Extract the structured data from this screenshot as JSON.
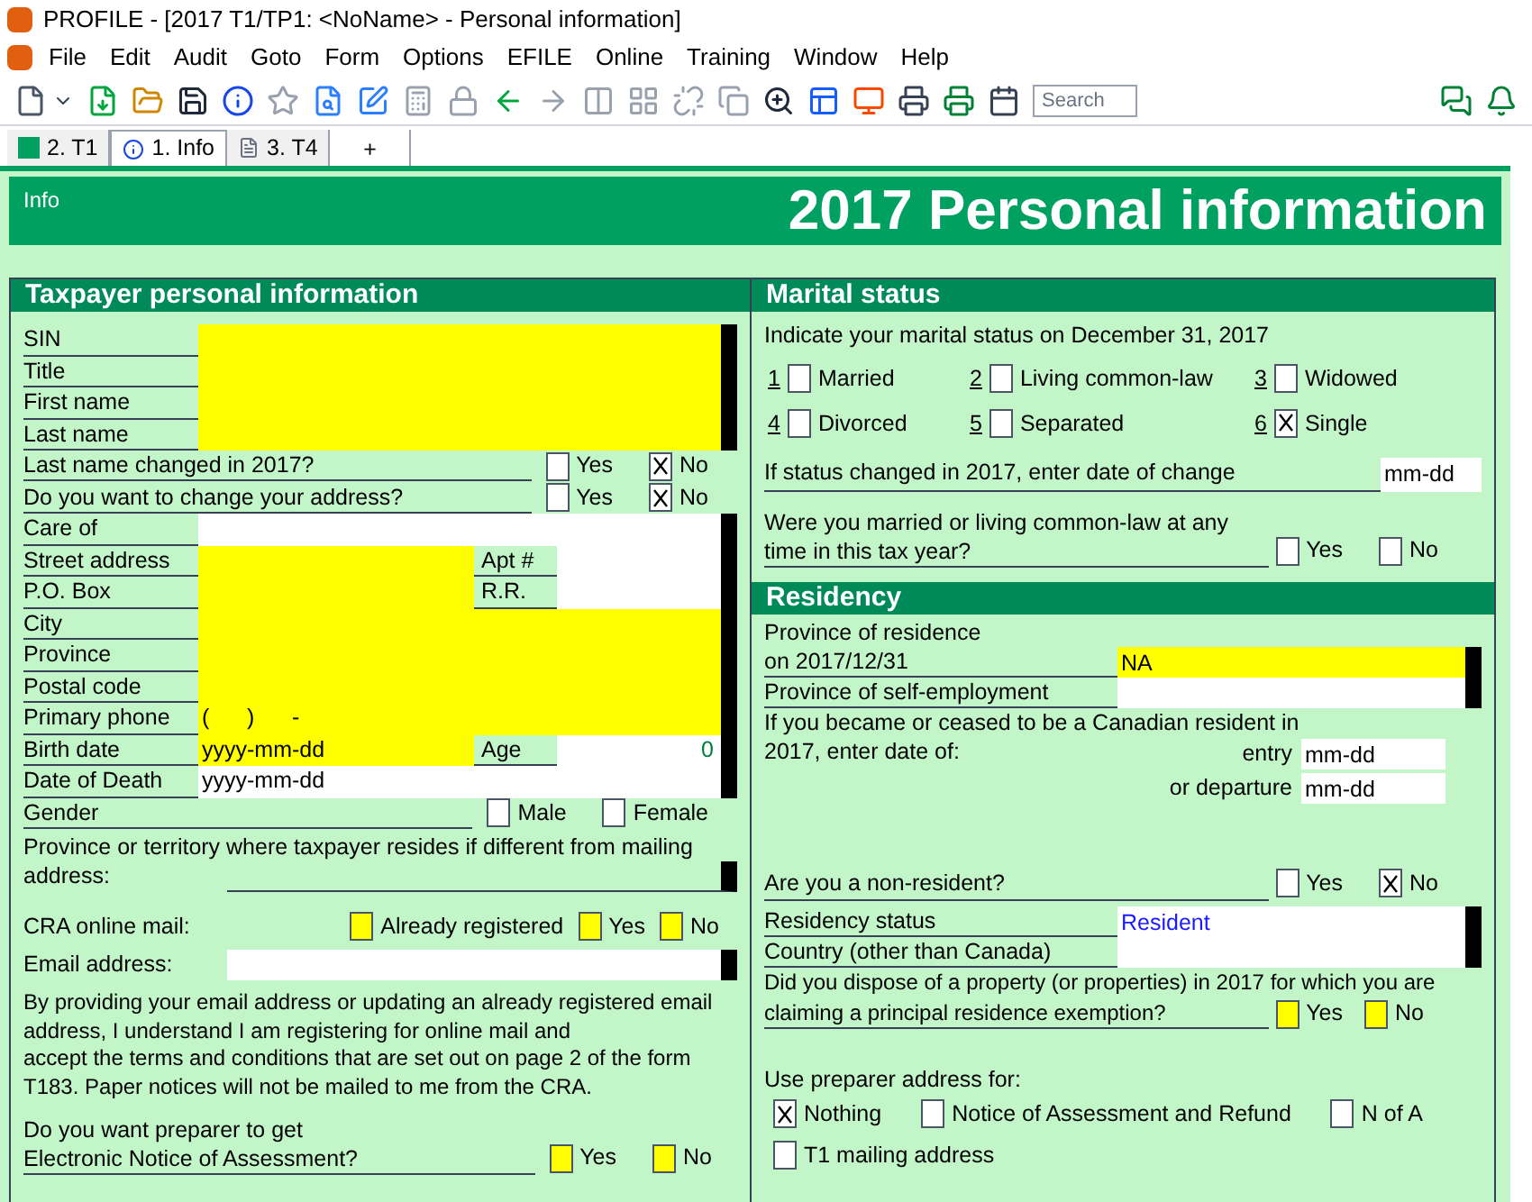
{
  "window": {
    "title": "PROFILE - [2017 T1/TP1: <NoName> - Personal information]"
  },
  "menu": [
    "File",
    "Edit",
    "Audit",
    "Goto",
    "Form",
    "Options",
    "EFILE",
    "Online",
    "Training",
    "Window",
    "Help"
  ],
  "toolbar": {
    "search_placeholder": "Search"
  },
  "tabs": [
    {
      "label": "2. T1",
      "selected": false
    },
    {
      "label": "1. Info",
      "selected": true
    },
    {
      "label": "3. T4",
      "selected": false
    }
  ],
  "add_tab": "+",
  "header": {
    "tag": "Info",
    "title": "2017 Personal information"
  },
  "taxpayer": {
    "title": "Taxpayer personal information",
    "rows": [
      {
        "kind": "field",
        "label": "SIN",
        "required": true
      },
      {
        "kind": "field",
        "label": "Title",
        "required": true
      },
      {
        "kind": "field",
        "label": "First name",
        "required": true
      },
      {
        "kind": "field",
        "label": "Last name",
        "required": true
      },
      {
        "kind": "choice",
        "label": "Last name changed in 2017?",
        "options": [
          {
            "label": "Yes",
            "checked": false
          },
          {
            "label": "No",
            "checked": true
          }
        ]
      },
      {
        "kind": "choice",
        "label": "Do you want to change your address?",
        "options": [
          {
            "label": "Yes",
            "checked": false
          },
          {
            "label": "No",
            "checked": true
          }
        ]
      },
      {
        "kind": "field",
        "label": "Care of",
        "required": false
      },
      {
        "kind": "field",
        "label": "Street address",
        "required": true,
        "side": {
          "label": "Apt #"
        }
      },
      {
        "kind": "field",
        "label": "P.O. Box",
        "required": true,
        "side": {
          "label": "R.R."
        }
      },
      {
        "kind": "field",
        "label": "City",
        "required": true
      },
      {
        "kind": "field",
        "label": "Province",
        "required": true
      },
      {
        "kind": "field",
        "label": "Postal code",
        "required": true
      },
      {
        "kind": "field",
        "label": "Primary phone",
        "required": true,
        "value": "(      )      -"
      },
      {
        "kind": "field",
        "label": "Birth date",
        "required": true,
        "value": "yyyy-mm-dd",
        "side": {
          "label": "Age",
          "value": "0"
        }
      },
      {
        "kind": "field",
        "label": "Date of Death",
        "required": false,
        "value": "yyyy-mm-dd"
      },
      {
        "kind": "choice",
        "label": "Gender",
        "options": [
          {
            "label": "Male",
            "checked": false
          },
          {
            "label": "Female",
            "checked": false
          }
        ]
      }
    ],
    "residence_question": [
      "Province or territory where taxpayer resides if different from mailing",
      "address:"
    ],
    "cra_mail": {
      "label": "CRA online mail:",
      "options": [
        {
          "label": "Already registered",
          "checked": false,
          "required": true
        },
        {
          "label": "Yes",
          "checked": false,
          "required": true
        },
        {
          "label": "No",
          "checked": false,
          "required": true
        }
      ]
    },
    "email": {
      "label": "Email address:"
    },
    "consent": "By providing your email address or updating an already registered email\naddress, I understand I am registering for online mail and\naccept the terms and conditions that are set out on page 2 of the form\nT183. Paper notices will not be mailed to me from the CRA.",
    "preparer_noa": {
      "label": "Do you want preparer to get\nElectronic Notice of Assessment?",
      "options": [
        {
          "label": "Yes",
          "checked": false,
          "required": true
        },
        {
          "label": "No",
          "checked": false,
          "required": true
        }
      ]
    }
  },
  "marital": {
    "title": "Marital status",
    "intro": "Indicate your marital status on December 31, 2017",
    "options": [
      {
        "number": "1",
        "label": "Married",
        "checked": false
      },
      {
        "number": "2",
        "label": "Living common-law",
        "checked": false
      },
      {
        "number": "3",
        "label": "Widowed",
        "checked": false
      },
      {
        "number": "4",
        "label": "Divorced",
        "checked": false
      },
      {
        "number": "5",
        "label": "Separated",
        "checked": false
      },
      {
        "number": "6",
        "label": "Single",
        "checked": true
      }
    ],
    "change_date": {
      "label": "If status changed in 2017, enter date of change",
      "value": "mm-dd"
    },
    "question": {
      "label": "Were you married or living common-law at any\ntime in this tax year?",
      "options": [
        {
          "label": "Yes",
          "checked": false
        },
        {
          "label": "No",
          "checked": false
        }
      ]
    }
  },
  "residency": {
    "title": "Residency",
    "province": {
      "label": "Province of residence\non 2017/12/31",
      "value": "NA",
      "required": true
    },
    "self_employment": {
      "label": "Province of self-employment"
    },
    "became": {
      "label_lines": [
        "If you became or ceased to be a Canadian resident in",
        "2017, enter date of:"
      ],
      "entry_label": "entry",
      "entry_value": "mm-dd",
      "departure_label": "or departure",
      "departure_value": "mm-dd"
    },
    "non_resident": {
      "label": "Are you a non-resident?",
      "options": [
        {
          "label": "Yes",
          "checked": false
        },
        {
          "label": "No",
          "checked": true
        }
      ]
    },
    "status": {
      "label": "Residency status",
      "value": "Resident"
    },
    "country": {
      "label": "Country (other than Canada)"
    },
    "dispose": {
      "label_lines": [
        "Did you dispose of a property (or properties) in 2017 for which you are",
        "claiming a principal residence exemption?"
      ],
      "options": [
        {
          "label": "Yes",
          "checked": false,
          "required": true
        },
        {
          "label": "No",
          "checked": false,
          "required": true
        }
      ]
    },
    "preparer_address": {
      "label": "Use preparer address for:",
      "options": [
        {
          "label": "Nothing",
          "checked": true
        },
        {
          "label": "Notice of Assessment and Refund",
          "checked": false
        },
        {
          "label": "N of A",
          "checked": false
        },
        {
          "label": "T1 mailing address",
          "checked": false
        }
      ]
    }
  }
}
